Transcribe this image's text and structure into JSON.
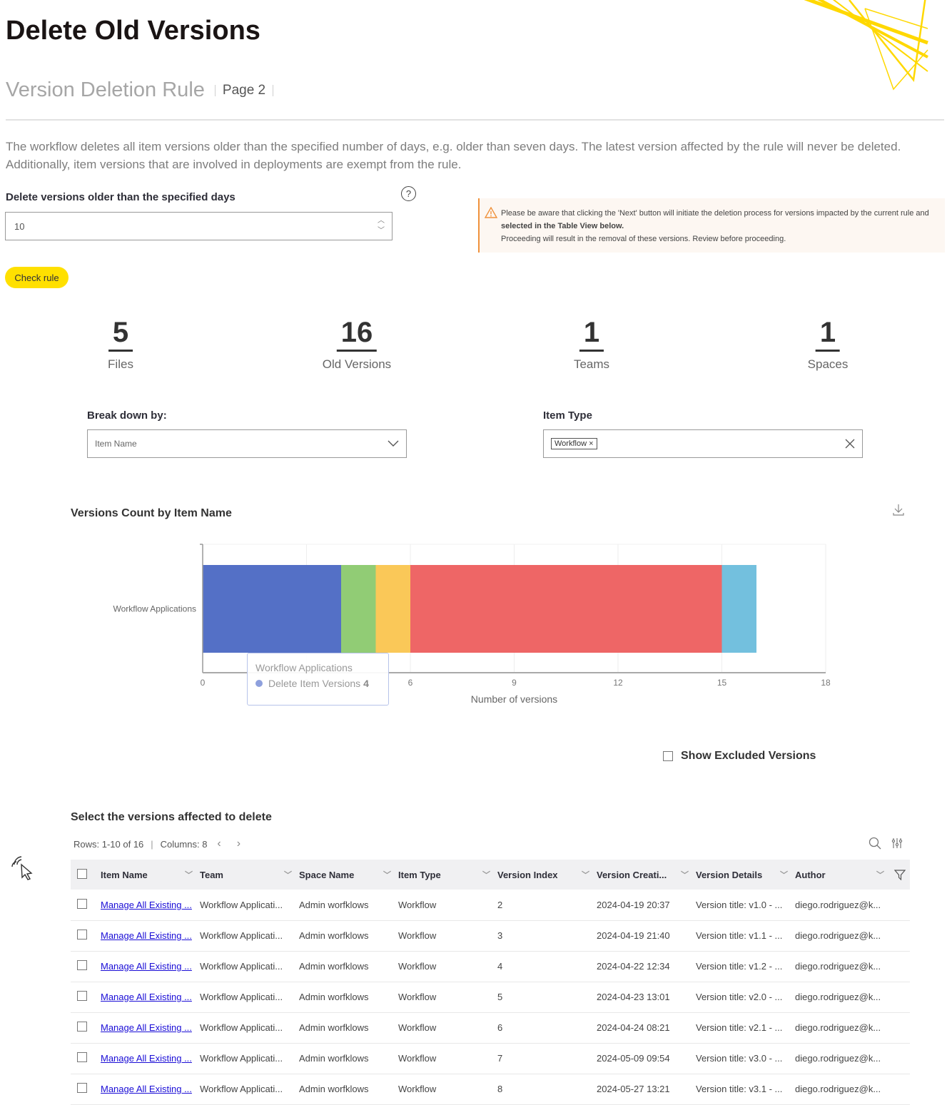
{
  "header": {
    "title": "Delete Old Versions",
    "subtitle": "Version Deletion Rule",
    "page_label": "Page 2"
  },
  "description": "The workflow deletes all item versions older than the specified number of days, e.g. older than seven days. The latest version affected by the rule will never be deleted. Additionally, item versions that are involved in deployments are exempt from the rule.",
  "rule": {
    "days_label": "Delete versions older than the specified days",
    "days_value": "10",
    "help_icon": "question-circle-icon",
    "check_button": "Check rule"
  },
  "warning": {
    "icon": "warning-triangle-icon",
    "line1_prefix": "Please be aware that clicking the 'Next' button will initiate the deletion process for versions impacted by the current rule and ",
    "line1_bold": "selected in the Table View below.",
    "line2": "Proceeding will result in the removal of these versions. Review before proceeding."
  },
  "stats": [
    {
      "value": "5",
      "label": "Files"
    },
    {
      "value": "16",
      "label": "Old Versions"
    },
    {
      "value": "1",
      "label": "Teams"
    },
    {
      "value": "1",
      "label": "Spaces"
    }
  ],
  "filters": {
    "breakdown_label": "Break down by:",
    "breakdown_value": "Item Name",
    "item_type_label": "Item Type",
    "item_type_chip": "Workflow"
  },
  "chart_section": {
    "title": "Versions Count by Item Name",
    "download_icon": "download-icon"
  },
  "chart_data": {
    "type": "bar",
    "orientation": "horizontal",
    "stacked": true,
    "title": "Versions Count by Item Name",
    "categories": [
      "Workflow Applications"
    ],
    "series": [
      {
        "name": "Delete Item Versions",
        "values": [
          4
        ],
        "color": "#5470c6"
      },
      {
        "name": "",
        "values": [
          1
        ],
        "color": "#91cc75"
      },
      {
        "name": "",
        "values": [
          1
        ],
        "color": "#fac858"
      },
      {
        "name": "",
        "values": [
          9
        ],
        "color": "#ee6666"
      },
      {
        "name": "",
        "values": [
          1
        ],
        "color": "#73c0de"
      }
    ],
    "xlabel": "Number of versions",
    "ylabel": "",
    "xlim": [
      0,
      18
    ],
    "xticks": [
      0,
      3,
      6,
      9,
      12,
      15,
      18
    ],
    "grid": true,
    "tooltip": {
      "title": "Workflow Applications",
      "series": "Delete Item Versions",
      "value": "4"
    }
  },
  "excluded": {
    "label": "Show Excluded Versions",
    "checked": false
  },
  "table": {
    "title": "Select the versions affected to delete",
    "rows_info": "Rows: 1-10 of 16",
    "columns_info": "Columns: 8",
    "columns": [
      "Item Name",
      "Team",
      "Space Name",
      "Item Type",
      "Version Index",
      "Version Creati...",
      "Version Details",
      "Author"
    ],
    "rows": [
      [
        "Manage All Existing ...",
        "Workflow Applicati...",
        "Admin worfklows",
        "Workflow",
        "2",
        "2024-04-19 20:37",
        "Version title: v1.0 - ...",
        "diego.rodriguez@k..."
      ],
      [
        "Manage All Existing ...",
        "Workflow Applicati...",
        "Admin worfklows",
        "Workflow",
        "3",
        "2024-04-19 21:40",
        "Version title: v1.1 - ...",
        "diego.rodriguez@k..."
      ],
      [
        "Manage All Existing ...",
        "Workflow Applicati...",
        "Admin worfklows",
        "Workflow",
        "4",
        "2024-04-22 12:34",
        "Version title: v1.2 - ...",
        "diego.rodriguez@k..."
      ],
      [
        "Manage All Existing ...",
        "Workflow Applicati...",
        "Admin worfklows",
        "Workflow",
        "5",
        "2024-04-23 13:01",
        "Version title: v2.0 - ...",
        "diego.rodriguez@k..."
      ],
      [
        "Manage All Existing ...",
        "Workflow Applicati...",
        "Admin worfklows",
        "Workflow",
        "6",
        "2024-04-24 08:21",
        "Version title: v2.1 - ...",
        "diego.rodriguez@k..."
      ],
      [
        "Manage All Existing ...",
        "Workflow Applicati...",
        "Admin worfklows",
        "Workflow",
        "7",
        "2024-05-09 09:54",
        "Version title: v3.0 - ...",
        "diego.rodriguez@k..."
      ],
      [
        "Manage All Existing ...",
        "Workflow Applicati...",
        "Admin worfklows",
        "Workflow",
        "8",
        "2024-05-27 13:21",
        "Version title: v3.1 - ...",
        "diego.rodriguez@k..."
      ]
    ]
  },
  "colors": {
    "accent": "#ffe000",
    "warning": "#f0923c",
    "link": "#1a0dd6"
  }
}
